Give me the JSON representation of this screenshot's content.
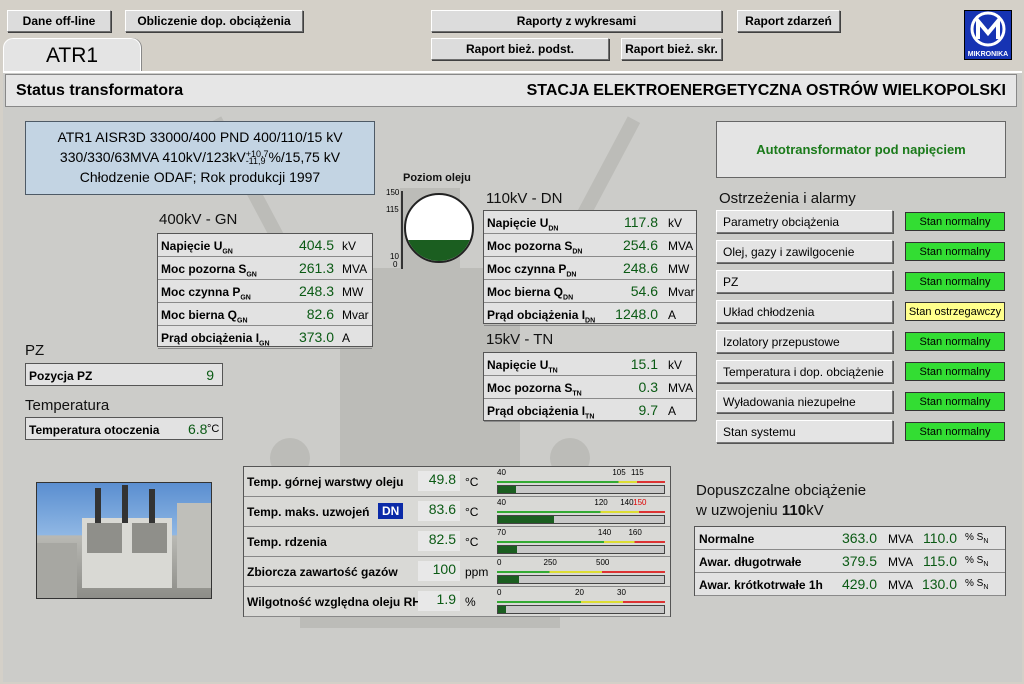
{
  "toolbar": {
    "offline": "Dane off-line",
    "calc": "Obliczenie dop. obciążenia",
    "reports_charts": "Raporty z wykresami",
    "event_report": "Raport zdarzeń",
    "curr_report_basic": "Raport bież. podst.",
    "curr_report_short": "Raport bież. skr.",
    "logo_text": "MIKRONIKA"
  },
  "tab": {
    "label": "ATR1"
  },
  "header": {
    "left": "Status transformatora",
    "right": "STACJA ELEKTROENERGETYCZNA  OSTRÓW WIELKOPOLSKI"
  },
  "info": {
    "line1": "ATR1 AISR3D 33000/400 PND 400/110/15 kV",
    "line2_a": "330/330/63MVA 410kV/123kV",
    "line2_sup": "+10,7",
    "line2_sub": "-11,9",
    "line2_b": "%/15,75 kV",
    "line3": "Chłodzenie ODAF; Rok produkcji 1997"
  },
  "oil": {
    "title": "Poziom oleju",
    "ticks": [
      "150",
      "115",
      "10",
      "0"
    ],
    "level": 0.32
  },
  "gn": {
    "title": "400kV - GN",
    "rows": [
      {
        "label": "Napięcie U",
        "sub": "GN",
        "value": "404.5",
        "unit": "kV"
      },
      {
        "label": "Moc pozorna S",
        "sub": "GN",
        "value": "261.3",
        "unit": "MVA"
      },
      {
        "label": "Moc czynna P",
        "sub": "GN",
        "value": "248.3",
        "unit": "MW"
      },
      {
        "label": "Moc bierna Q",
        "sub": "GN",
        "value": "82.6",
        "unit": "Mvar"
      },
      {
        "label": "Prąd obciążenia I",
        "sub": "GN",
        "value": "373.0",
        "unit": "A"
      }
    ]
  },
  "dn": {
    "title": "110kV - DN",
    "rows": [
      {
        "label": "Napięcie U",
        "sub": "DN",
        "value": "117.8",
        "unit": "kV"
      },
      {
        "label": "Moc pozorna S",
        "sub": "DN",
        "value": "254.6",
        "unit": "MVA"
      },
      {
        "label": "Moc czynna P",
        "sub": "DN",
        "value": "248.6",
        "unit": "MW"
      },
      {
        "label": "Moc bierna Q",
        "sub": "DN",
        "value": "54.6",
        "unit": "Mvar"
      },
      {
        "label": "Prąd obciążenia I",
        "sub": "DN",
        "value": "1248.0",
        "unit": "A"
      }
    ]
  },
  "tn": {
    "title": "15kV - TN",
    "rows": [
      {
        "label": "Napięcie U",
        "sub": "TN",
        "value": "15.1",
        "unit": "kV"
      },
      {
        "label": "Moc pozorna S",
        "sub": "TN",
        "value": "0.3",
        "unit": "MVA"
      },
      {
        "label": "Prąd obciążenia I",
        "sub": "TN",
        "value": "9.7",
        "unit": "A"
      }
    ]
  },
  "pz": {
    "title": "PZ",
    "label": "Pozycja PZ",
    "value": "9"
  },
  "temp": {
    "title": "Temperatura",
    "label": "Temperatura otoczenia",
    "value": "6.8",
    "unit": "°C"
  },
  "status": {
    "text": "Autotransformator pod napięciem"
  },
  "alarms": {
    "title": "Ostrzeżenia i alarmy",
    "items": [
      {
        "label": "Parametry obciążenia",
        "state": "Stan normalny",
        "color": "green"
      },
      {
        "label": "Olej, gazy i zawilgocenie",
        "state": "Stan normalny",
        "color": "green"
      },
      {
        "label": "PZ",
        "state": "Stan normalny",
        "color": "green"
      },
      {
        "label": "Układ chłodzenia",
        "state": "Stan ostrzegawczy",
        "color": "yellow"
      },
      {
        "label": "Izolatory przepustowe",
        "state": "Stan normalny",
        "color": "green"
      },
      {
        "label": "Temperatura i dop. obciążenie",
        "state": "Stan normalny",
        "color": "green"
      },
      {
        "label": "Wyładowania niezupełne",
        "state": "Stan normalny",
        "color": "green"
      },
      {
        "label": "Stan systemu",
        "state": "Stan normalny",
        "color": "green"
      }
    ]
  },
  "gauges": [
    {
      "label": "Temp. górnej warstwy oleju",
      "value": "49.8",
      "unit": "°C",
      "min": 40,
      "max": 130,
      "level": 49.8,
      "ticks": [
        "40",
        "105",
        "115"
      ]
    },
    {
      "label": "Temp. maks. uzwojeń",
      "badge": "DN",
      "value": "83.6",
      "unit": "°C",
      "min": 40,
      "max": 170,
      "level": 83.6,
      "ticks": [
        "40",
        "120",
        "140",
        "150"
      ]
    },
    {
      "label": "Temp. rdzenia",
      "value": "82.5",
      "unit": "°C",
      "min": 70,
      "max": 180,
      "level": 82.5,
      "ticks": [
        "70",
        "140",
        "160"
      ]
    },
    {
      "label": "Zbiorcza zawartość gazów",
      "value": "100",
      "unit": "ppm",
      "min": 0,
      "max": 800,
      "level": 100,
      "ticks": [
        "0",
        "250",
        "500"
      ]
    },
    {
      "label": "Wilgotność względna oleju RH",
      "value": "1.9",
      "unit": "%",
      "min": 0,
      "max": 40,
      "level": 1.9,
      "ticks": [
        "0",
        "20",
        "30"
      ]
    }
  ],
  "load": {
    "title1": "Dopuszczalne obciążenie",
    "title2_a": "w uzwojeniu ",
    "title2_b": "110",
    "title2_c": "kV",
    "rows": [
      {
        "label": "Normalne",
        "mva": "363.0",
        "u1": "MVA",
        "pct": "110.0",
        "u2": "% S",
        "sub": "N"
      },
      {
        "label": "Awar. długotrwałe",
        "mva": "379.5",
        "u1": "MVA",
        "pct": "115.0",
        "u2": "% S",
        "sub": "N"
      },
      {
        "label": "Awar. krótkotrwałe 1h",
        "mva": "429.0",
        "u1": "MVA",
        "pct": "130.0",
        "u2": "% S",
        "sub": "N"
      }
    ]
  },
  "colors": {
    "value_green": "#0a5a14",
    "ok": "#33dd33",
    "warn": "#ffff8c",
    "info_bg": "#c3d4e3",
    "badge": "#0b2aa8"
  }
}
